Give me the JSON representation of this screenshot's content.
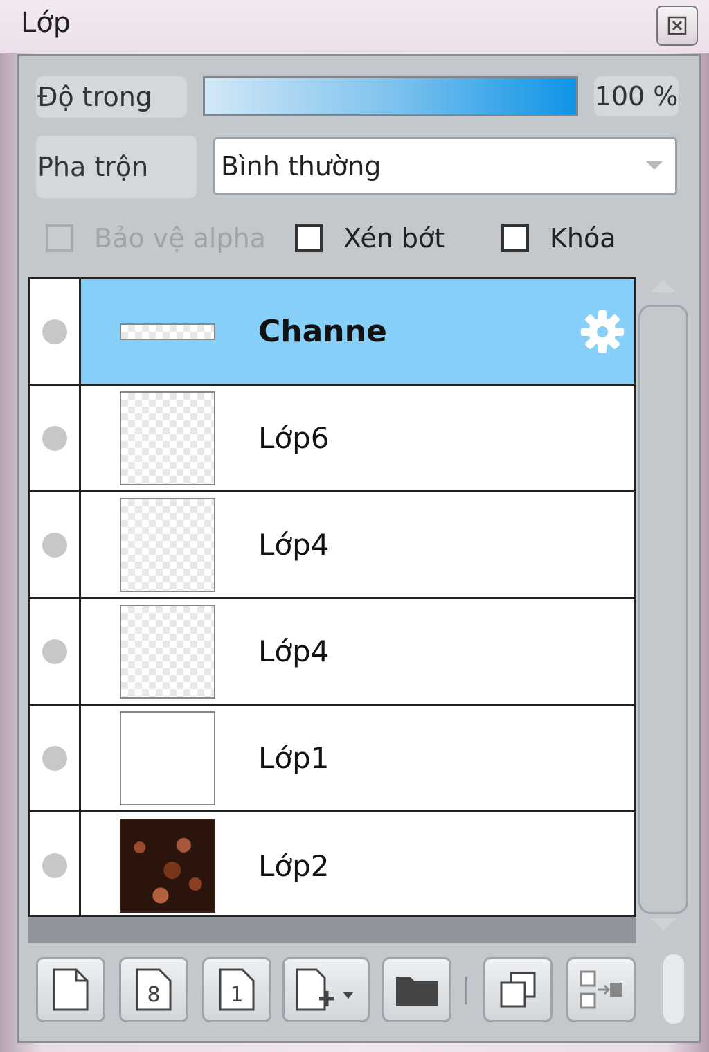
{
  "window": {
    "title": "Lớp"
  },
  "opacity": {
    "label": "Độ trong",
    "value_text": "100 %",
    "value": 100
  },
  "blend": {
    "label": "Pha trộn",
    "selected": "Bình thường"
  },
  "checkboxes": [
    {
      "label": "Bảo vệ alpha",
      "checked": false,
      "enabled": false
    },
    {
      "label": "Xén bớt",
      "checked": false,
      "enabled": true
    },
    {
      "label": "Khóa",
      "checked": false,
      "enabled": true
    }
  ],
  "layers": [
    {
      "name": "Channe",
      "selected": true,
      "thumb": "strip"
    },
    {
      "name": "Lớp6",
      "selected": false,
      "thumb": "transparent"
    },
    {
      "name": "Lớp4",
      "selected": false,
      "thumb": "transparent"
    },
    {
      "name": "Lớp4",
      "selected": false,
      "thumb": "transparent"
    },
    {
      "name": "Lớp1",
      "selected": false,
      "thumb": "white"
    },
    {
      "name": "Lớp2",
      "selected": false,
      "thumb": "texture"
    }
  ],
  "toolbar": {
    "icons": [
      "new-layer-icon",
      "new-8bit-layer-icon",
      "new-1bit-layer-icon",
      "add-layer-menu-icon",
      "folder-icon",
      "duplicate-icon",
      "merge-down-icon"
    ]
  },
  "colors": {
    "selected_row": "#86cff8",
    "opacity_start": "#d2e8f7",
    "opacity_end": "#0e94e6"
  }
}
